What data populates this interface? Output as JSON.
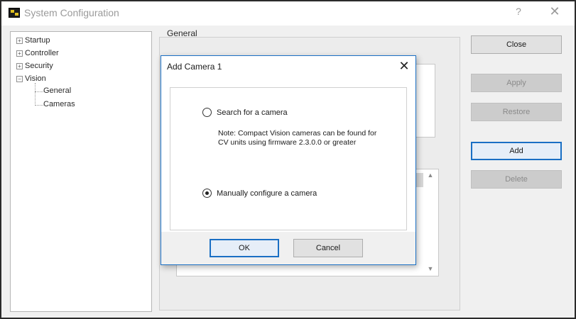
{
  "window": {
    "title": "System Configuration",
    "help_label": "?",
    "close_label": "✕"
  },
  "tree": {
    "items": [
      {
        "label": "Startup",
        "expander": "+"
      },
      {
        "label": "Controller",
        "expander": "+"
      },
      {
        "label": "Security",
        "expander": "+"
      },
      {
        "label": "Vision",
        "expander": "−"
      },
      {
        "label": "General"
      },
      {
        "label": "Cameras"
      }
    ]
  },
  "main": {
    "group_label": "General"
  },
  "buttons": {
    "close": "Close",
    "apply": "Apply",
    "restore": "Restore",
    "add": "Add",
    "delete": "Delete"
  },
  "dialog": {
    "title": "Add Camera 1",
    "close_label": "✕",
    "search_option": "Search for a camera",
    "note": "Note: Compact Vision cameras can be found for CV units using firmware 2.3.0.0 or greater",
    "manual_option": "Manually configure a camera",
    "selected": "manual",
    "ok": "OK",
    "cancel": "Cancel"
  },
  "icons": {
    "app": "app-icon",
    "scroll_up": "▲",
    "scroll_down": "▼"
  },
  "colors": {
    "accent": "#1a6fc4",
    "app_icon_yellow": "#e0c020"
  }
}
